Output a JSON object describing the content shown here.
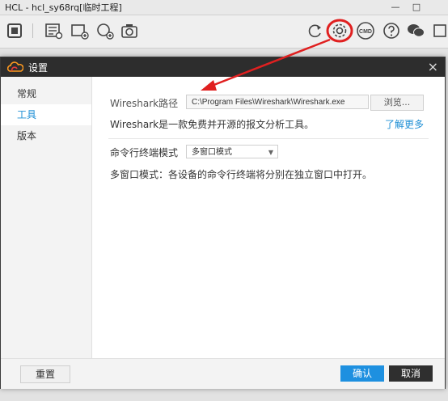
{
  "window": {
    "title": "HCL - hcl_sy68rq[临时工程]",
    "minimize": "—",
    "maximize": "□"
  },
  "toolbar": {
    "cmd_label": "CMD"
  },
  "dialog": {
    "title": "设置",
    "close": "×",
    "sidebar": [
      {
        "label": "常规"
      },
      {
        "label": "工具"
      },
      {
        "label": "版本"
      }
    ],
    "tools": {
      "wireshark_label": "Wireshark路径",
      "wireshark_path": "C:\\Program Files\\Wireshark\\Wireshark.exe",
      "browse": "浏览...",
      "wireshark_desc": "Wireshark是一款免费并开源的报文分析工具。",
      "learn_more": "了解更多",
      "cmd_mode_label": "命令行终端模式",
      "cmd_mode_value": "多窗口模式",
      "cmd_mode_desc": "多窗口模式：各设备的命令行终端将分别在独立窗口中打开。"
    },
    "footer": {
      "reset": "重置",
      "ok": "确认",
      "cancel": "取消"
    }
  },
  "colors": {
    "accent": "#1e8fd5",
    "annotation": "#e02020"
  }
}
